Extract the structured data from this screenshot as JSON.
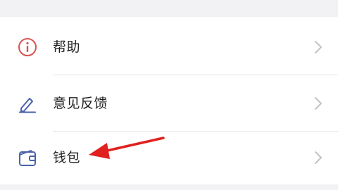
{
  "menu": {
    "items": [
      {
        "label": "帮助",
        "icon": "info-circle-icon",
        "icon_color": "#d9534f"
      },
      {
        "label": "意见反馈",
        "icon": "pencil-icon",
        "icon_color": "#4a63a8"
      },
      {
        "label": "钱包",
        "icon": "wallet-icon",
        "icon_color": "#4a63a8"
      }
    ],
    "chevron_color": "#c2c2c8"
  },
  "annotation": {
    "arrow_color": "#e0211f",
    "points_to": "钱包"
  }
}
